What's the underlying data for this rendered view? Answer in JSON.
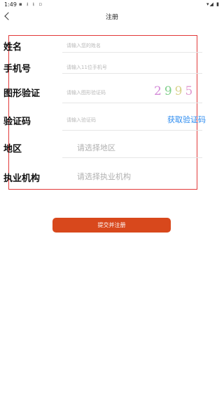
{
  "status_bar": {
    "time": "1:49"
  },
  "header": {
    "title": "注册"
  },
  "form": {
    "name_label": "姓名",
    "name_placeholder": "请输入您的姓名",
    "phone_label": "手机号",
    "phone_placeholder": "请输入11位手机号",
    "captcha_label": "图形验证",
    "captcha_placeholder": "请输入图形验证码",
    "captcha_digits": [
      "2",
      "9",
      "9",
      "5"
    ],
    "sms_label": "验证码",
    "sms_placeholder": "请输入验证码",
    "sms_button": "获取验证码",
    "region_label": "地区",
    "region_placeholder": "请选择地区",
    "org_label": "执业机构",
    "org_placeholder": "请选择执业机构"
  },
  "submit_label": "提交并注册",
  "colors": {
    "accent": "#d8481c",
    "link": "#2d8cf0",
    "outline": "#e23a3a"
  }
}
